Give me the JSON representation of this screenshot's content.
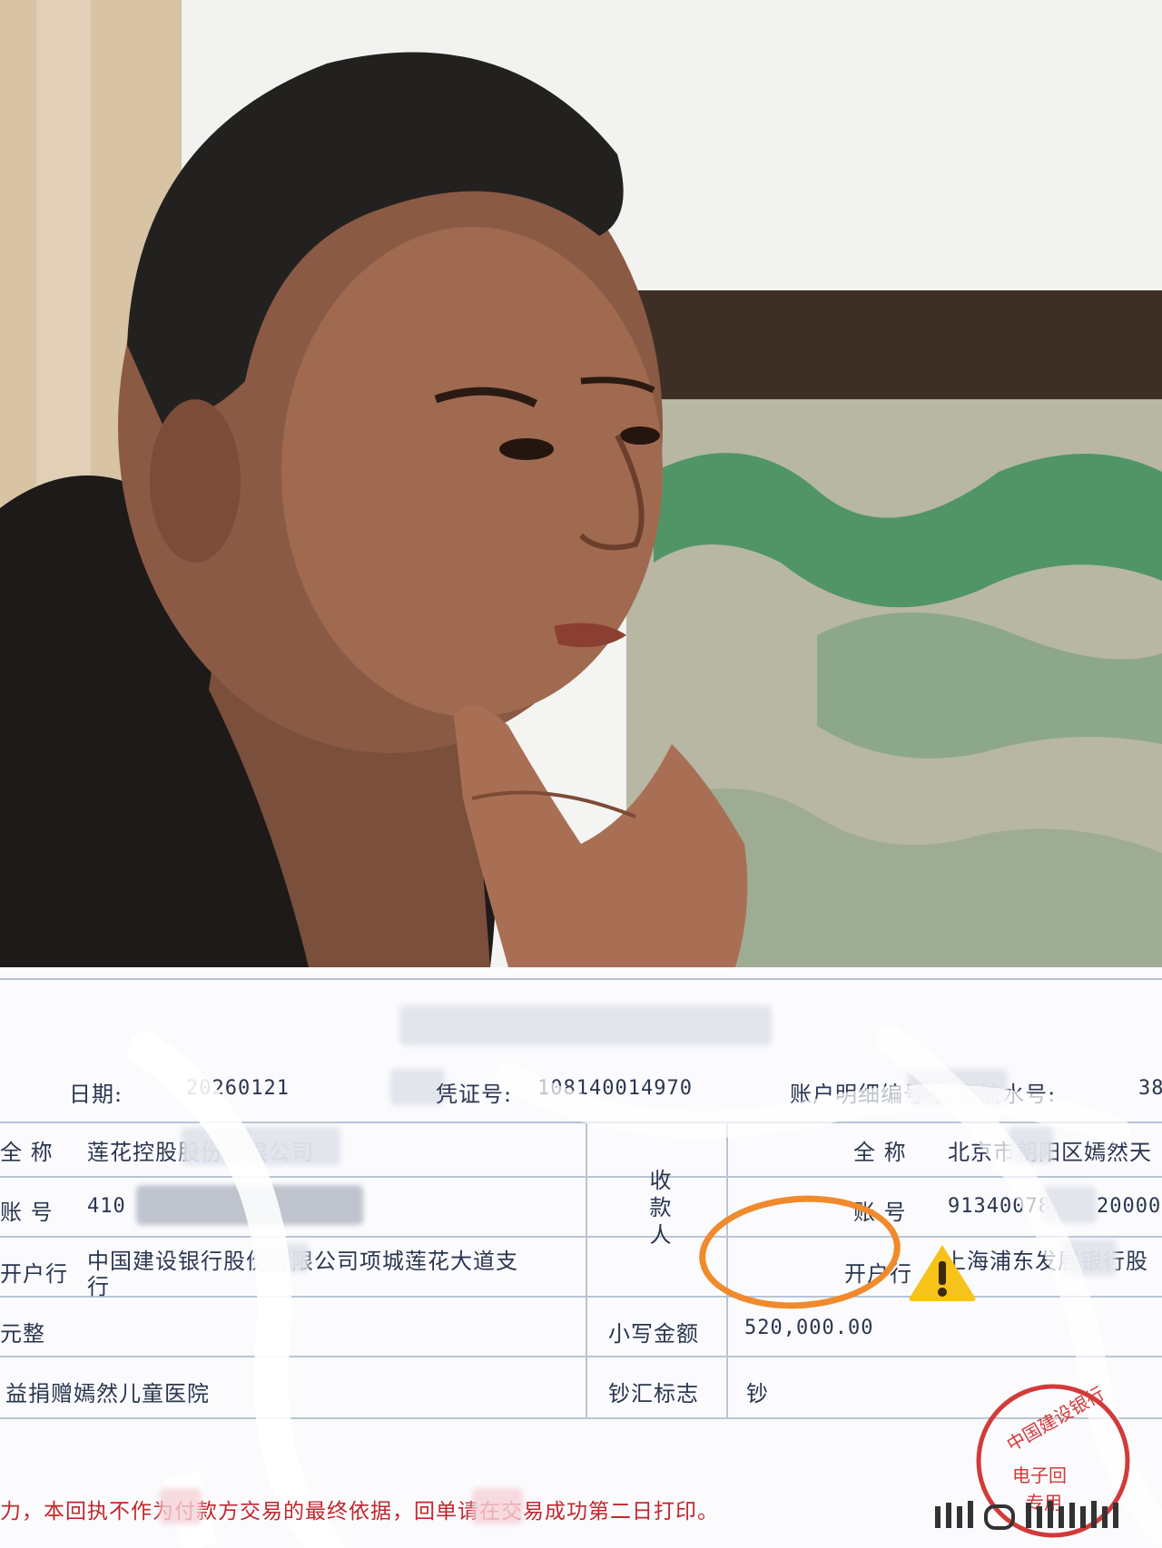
{
  "receipt": {
    "date_label": "日期:",
    "date_value": "20260121",
    "voucher_label": "凭证号:",
    "voucher_value": "108140014970",
    "detail_label": "账户明细编号-交易流水号:",
    "detail_value": "38",
    "payer_name_label": "全 称",
    "payer_name_value": "莲花控股股份有限公司",
    "payer_account_label": "账 号",
    "payer_account_value": "410",
    "payer_bank_label": "开户行",
    "payer_bank_value_line1": "中国建设银行股份有限公司项城莲花大道支",
    "payer_bank_value_line2": "行",
    "amount_words_label": "元整",
    "purpose_text": "益捐赠嫣然儿童医院",
    "payee_label": "收款人",
    "payee_name_label": "全 称",
    "payee_name_value": "北京市朝阳区嫣然天",
    "payee_account_label": "账 号",
    "payee_account_value": "91340078",
    "payee_account_value_end": "20000",
    "payee_bank_label": "开户行",
    "payee_bank_value": "上海浦东发展银行股",
    "amount_label": "小写金额",
    "amount_value": "520,000.00",
    "cash_label": "钞汇标志",
    "cash_value": "钞",
    "footer_note": "力，本回执不作为付款方交易的最终依据，回单请在交易成功第二日打印。",
    "stamp_line1": "中国建设银行",
    "stamp_line2": "电子回",
    "stamp_line3": "专用"
  },
  "overlay": {
    "circle_color": "#f08a2c",
    "warning_color": "#f7c21a",
    "warning_icon": "warning-icon"
  }
}
